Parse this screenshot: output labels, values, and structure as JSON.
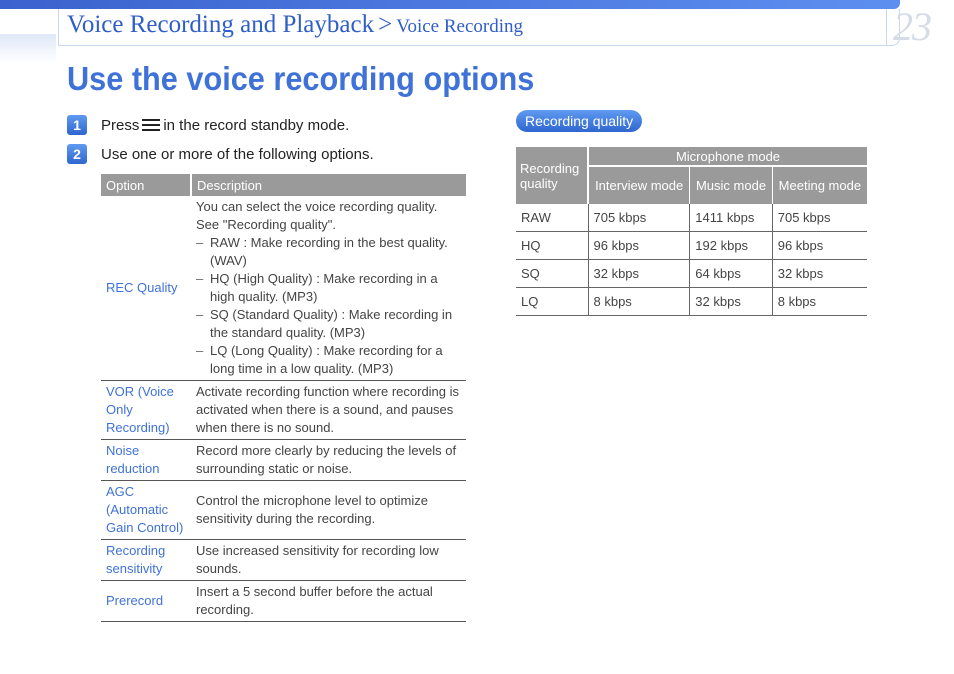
{
  "header": {
    "breadcrumb_main": "Voice Recording and Playback",
    "breadcrumb_sep": ">",
    "breadcrumb_sub": "Voice Recording",
    "page_number": "23"
  },
  "title": "Use the voice recording options",
  "steps": [
    {
      "num": "1",
      "before": "Press",
      "icon": "menu-icon",
      "after": "in the record standby mode."
    },
    {
      "num": "2",
      "text": "Use one or more of the following options."
    }
  ],
  "options_table": {
    "headers": [
      "Option",
      "Description"
    ],
    "rows": [
      {
        "option": "REC Quality",
        "description": "You can select the voice recording quality. See \"Recording quality\".",
        "items": [
          "RAW : Make recording in the best quality. (WAV)",
          "HQ (High Quality) : Make recording in a high quality. (MP3)",
          "SQ (Standard Quality) : Make recording in the standard quality. (MP3)",
          "LQ (Long Quality) : Make recording for a long time in a low quality. (MP3)"
        ]
      },
      {
        "option": "VOR (Voice Only Recording)",
        "description": "Activate recording function where recording is activated when there is a sound, and pauses when there is no sound."
      },
      {
        "option": "Noise reduction",
        "description": "Record more clearly by reducing the levels of surrounding static or noise."
      },
      {
        "option": "AGC (Automatic Gain Control)",
        "description": "Control the microphone level to optimize sensitivity during the recording."
      },
      {
        "option": "Recording sensitivity",
        "description": "Use increased sensitivity for recording low sounds."
      },
      {
        "option": "Prerecord",
        "description": "Insert a 5 second buffer before the actual recording."
      }
    ]
  },
  "quality_section": {
    "badge": "Recording quality",
    "table": {
      "corner": "Recording quality",
      "group_header": "Microphone mode",
      "modes": [
        "Interview mode",
        "Music mode",
        "Meeting mode"
      ],
      "rows": [
        {
          "quality": "RAW",
          "values": [
            "705 kbps",
            "1411 kbps",
            "705 kbps"
          ]
        },
        {
          "quality": "HQ",
          "values": [
            "96 kbps",
            "192 kbps",
            "96 kbps"
          ]
        },
        {
          "quality": "SQ",
          "values": [
            "32 kbps",
            "64 kbps",
            "32 kbps"
          ]
        },
        {
          "quality": "LQ",
          "values": [
            "8 kbps",
            "32 kbps",
            "8 kbps"
          ]
        }
      ]
    }
  },
  "colors": {
    "accent": "#3f72d8",
    "header_gray": "#9a9a9a",
    "badge_blue": "#2f66cf"
  }
}
